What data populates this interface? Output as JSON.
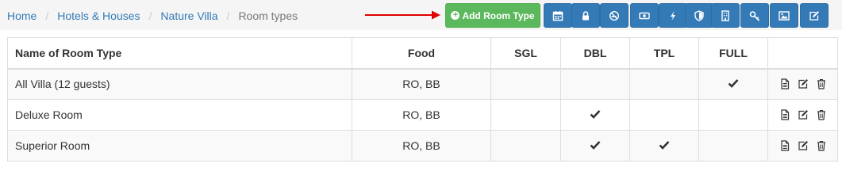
{
  "breadcrumb": {
    "items": [
      "Home",
      "Hotels & Houses",
      "Nature Villa"
    ],
    "active": "Room types"
  },
  "toolbar": {
    "add_label": "Add Room Type",
    "icons": [
      "calendar-icon",
      "lock-icon",
      "no-smoking-icon",
      "money-icon",
      "bolt-icon",
      "shield-icon",
      "building-icon",
      "key-icon",
      "image-icon",
      "edit-icon"
    ]
  },
  "table": {
    "headers": [
      "Name of Room Type",
      "Food",
      "SGL",
      "DBL",
      "TPL",
      "FULL",
      ""
    ],
    "rows": [
      {
        "name": "All Villa (12 guests)",
        "food": "RO, BB",
        "sgl": false,
        "dbl": false,
        "tpl": false,
        "full": true
      },
      {
        "name": "Deluxe Room",
        "food": "RO, BB",
        "sgl": false,
        "dbl": true,
        "tpl": false,
        "full": false
      },
      {
        "name": "Superior Room",
        "food": "RO, BB",
        "sgl": false,
        "dbl": true,
        "tpl": true,
        "full": false
      }
    ]
  },
  "colors": {
    "link": "#337ab7",
    "primary": "#337ab7",
    "success": "#5cb85c",
    "arrow": "#e00000"
  }
}
